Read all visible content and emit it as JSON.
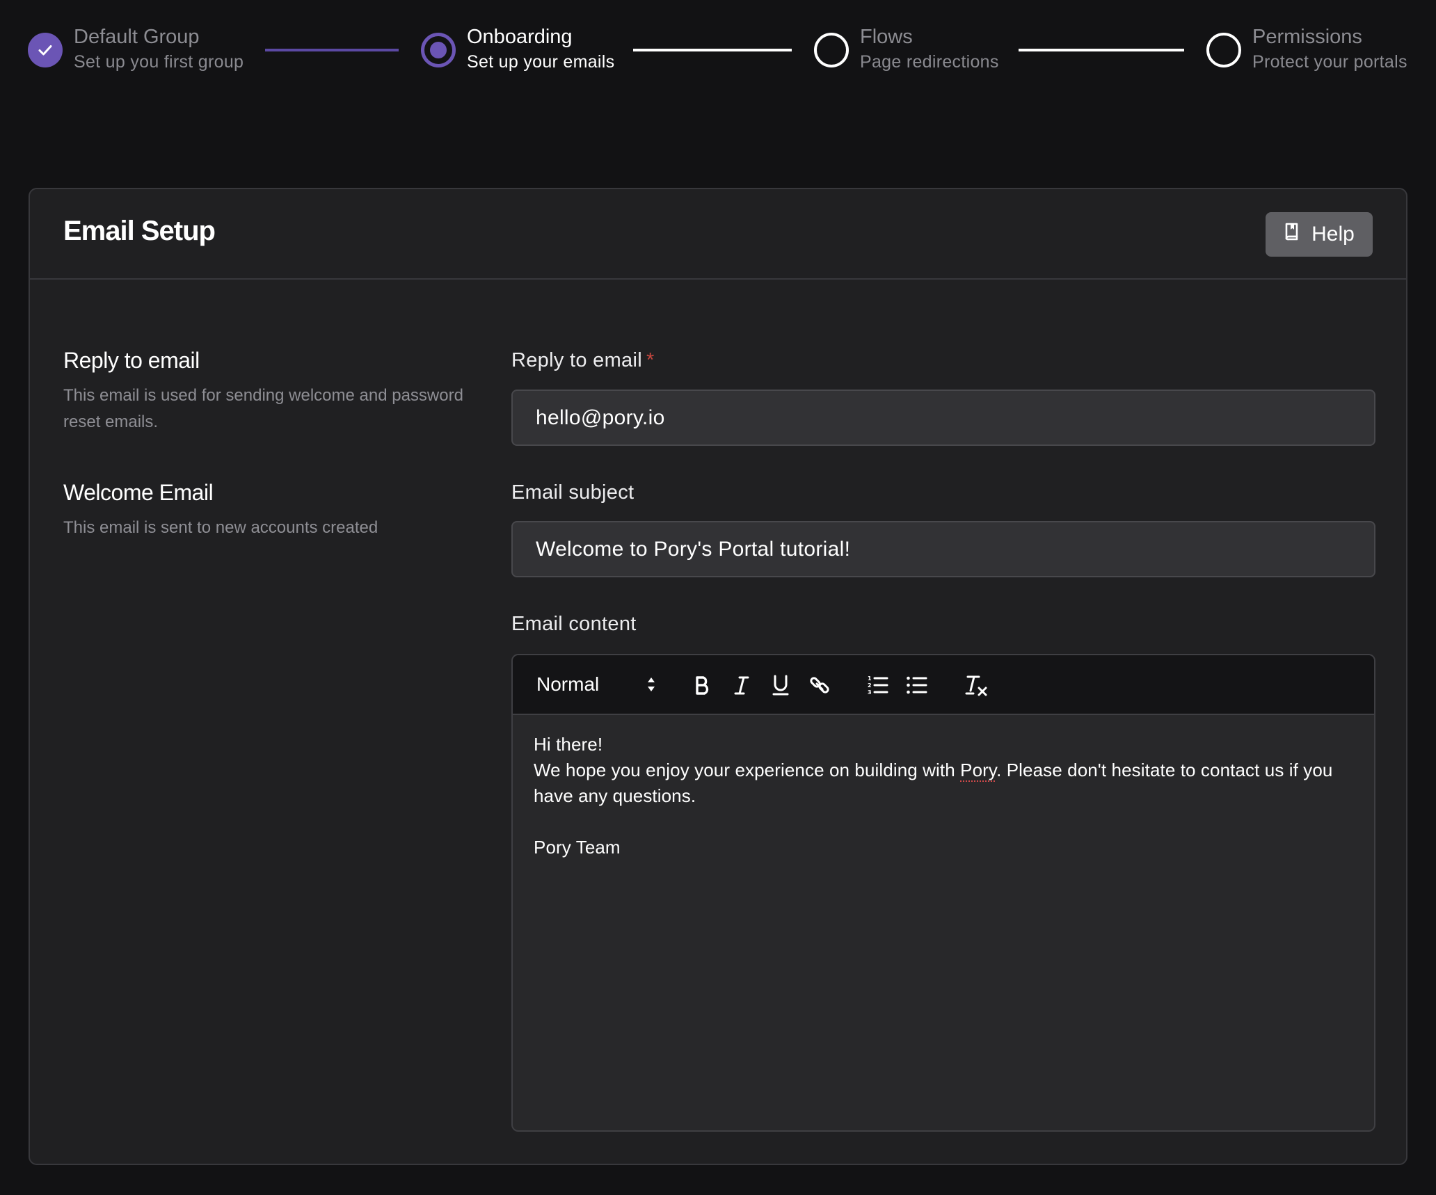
{
  "stepper": {
    "steps": [
      {
        "title": "Default Group",
        "subtitle": "Set up you first group",
        "state": "done"
      },
      {
        "title": "Onboarding",
        "subtitle": "Set up your emails",
        "state": "active"
      },
      {
        "title": "Flows",
        "subtitle": "Page redirections",
        "state": "todo"
      },
      {
        "title": "Permissions",
        "subtitle": "Protect your portals",
        "state": "todo"
      }
    ]
  },
  "card": {
    "title": "Email Setup",
    "help_label": "Help"
  },
  "sections": {
    "reply": {
      "title": "Reply to email",
      "description": "This email is used for sending welcome and password reset emails."
    },
    "welcome": {
      "title": "Welcome Email",
      "description": "This email is sent to new accounts created"
    }
  },
  "form": {
    "reply_label": "Reply to email",
    "required_mark": "*",
    "reply_value": "hello@pory.io",
    "subject_label": "Email subject",
    "subject_value": "Welcome to Pory's Portal tutorial!",
    "content_label": "Email content"
  },
  "editor": {
    "format_value": "Normal",
    "toolbar_icons": [
      "bold-icon",
      "italic-icon",
      "underline-icon",
      "link-icon",
      "ordered-list-icon",
      "bullet-list-icon",
      "clear-format-icon"
    ],
    "line1": "Hi there!",
    "line2_before": "We hope you enjoy your experience on building with ",
    "line2_word": "Pory",
    "line2_after": ". Please don't hesitate to contact us if you have any questions.",
    "signature": "Pory Team"
  },
  "colors": {
    "background": "#121214",
    "card": "#202022",
    "accent": "#6b55b5",
    "input": "#323235",
    "required": "#c8473f"
  }
}
